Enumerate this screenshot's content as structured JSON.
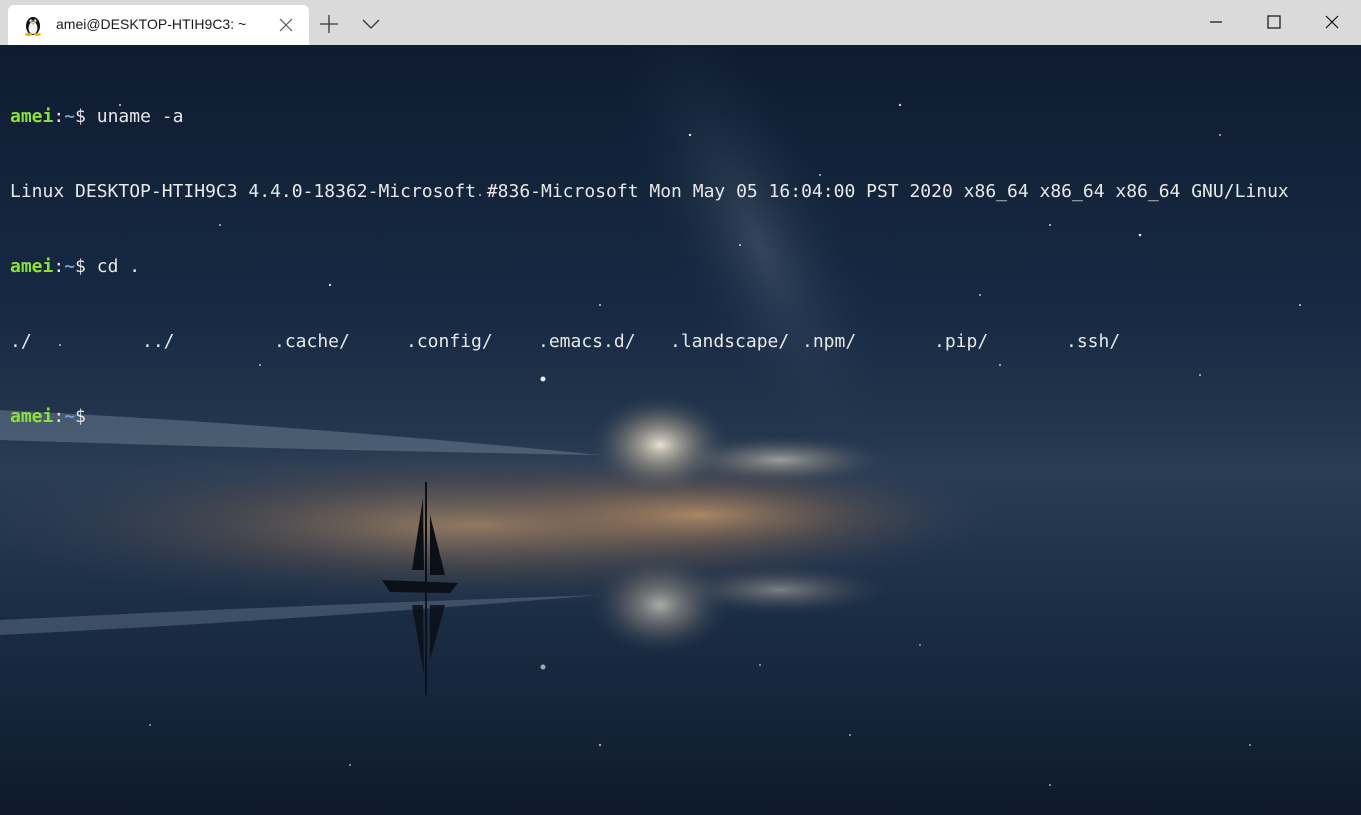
{
  "window": {
    "tab_title": "amei@DESKTOP-HTIH9C3: ~",
    "tab_icon": "linux-penguin-icon"
  },
  "terminal": {
    "lines": [
      {
        "user": "amei",
        "sep": ":",
        "path": "~",
        "prompt": "$ ",
        "command": "uname -a"
      },
      {
        "output": "Linux DESKTOP-HTIH9C3 4.4.0-18362-Microsoft #836-Microsoft Mon May 05 16:04:00 PST 2020 x86_64 x86_64 x86_64 GNU/Linux"
      },
      {
        "user": "amei",
        "sep": ":",
        "path": "~",
        "prompt": "$ ",
        "command": "cd ."
      },
      {
        "dirs": [
          "./",
          "../",
          ".cache/",
          ".config/",
          ".emacs.d/",
          ".landscape/",
          ".npm/",
          ".pip/",
          ".ssh/"
        ]
      },
      {
        "user": "amei",
        "sep": ":",
        "path": "~",
        "prompt": "$",
        "command": ""
      }
    ],
    "colors": {
      "user": "#8ae234",
      "path": "#729fcf",
      "text": "#e8e8e8"
    }
  }
}
